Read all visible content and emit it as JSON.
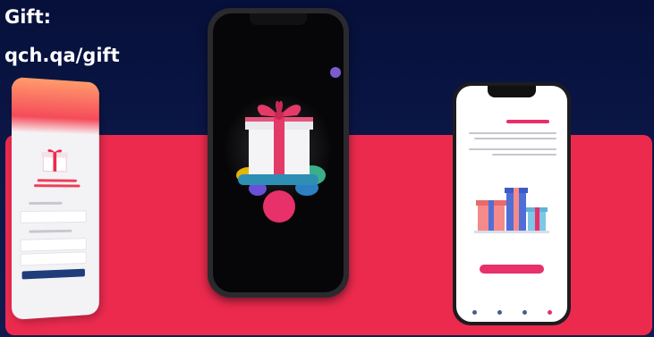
{
  "headline": {
    "line1": "Gift:",
    "line2": "qch.qa/gift"
  },
  "colors": {
    "background": "#0b1646",
    "banner": "#ec2a4e",
    "accent_pink": "#e8306a",
    "accent_teal": "#2d8fb3",
    "button_blue": "#1f3d7a"
  },
  "icons": {
    "left_phone": "gift-box-icon",
    "middle_phone": "gift-box-icon",
    "right_phone": "gift-boxes-icon"
  }
}
